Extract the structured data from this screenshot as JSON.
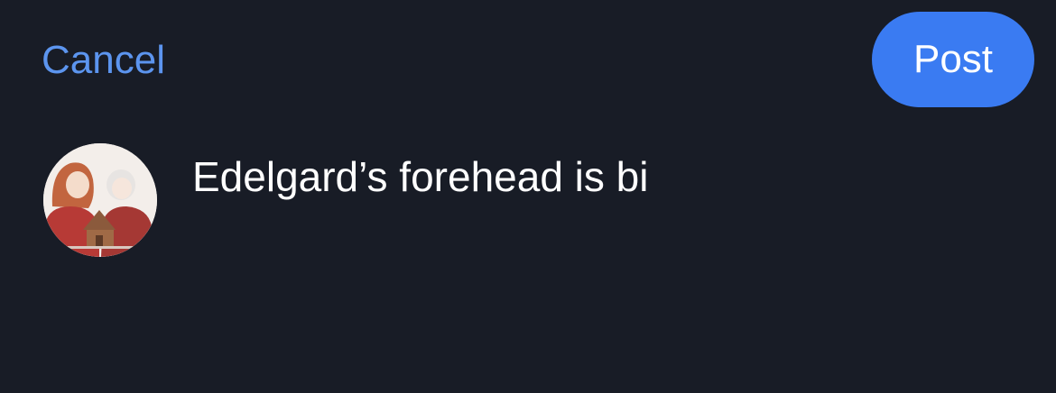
{
  "header": {
    "cancel_label": "Cancel",
    "post_label": "Post"
  },
  "composer": {
    "text": "Edelgard’s forehead is bi",
    "avatar_icon": "user-avatar-icon"
  },
  "colors": {
    "background": "#181c26",
    "cancel_text": "#5c95ef",
    "post_button": "#3a7bf2",
    "text": "#ffffff"
  }
}
